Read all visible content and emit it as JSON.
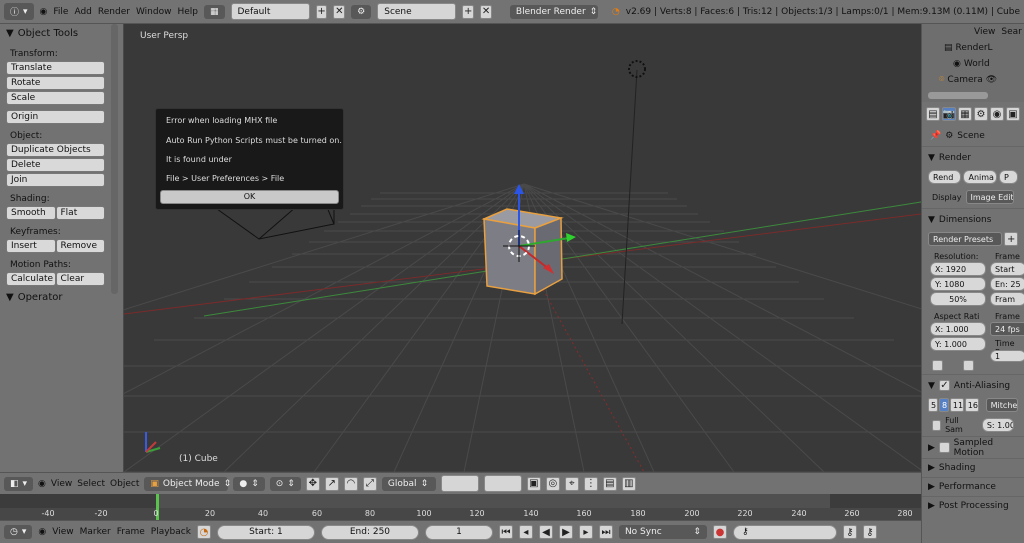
{
  "header": {
    "menus": [
      "File",
      "Add",
      "Render",
      "Window",
      "Help"
    ],
    "screen_layout": "Default",
    "scene": "Scene",
    "render_engine": "Blender Render",
    "stats": "v2.69 | Verts:8 | Faces:6 | Tris:12 | Objects:1/3 | Lamps:0/1 | Mem:9.13M (0.11M) | Cube"
  },
  "tool_shelf": {
    "title": "Object Tools",
    "transform_label": "Transform:",
    "translate": "Translate",
    "rotate": "Rotate",
    "scale": "Scale",
    "origin": "Origin",
    "object_label": "Object:",
    "duplicate": "Duplicate Objects",
    "delete": "Delete",
    "join": "Join",
    "shading_label": "Shading:",
    "smooth": "Smooth",
    "flat": "Flat",
    "keyframes_label": "Keyframes:",
    "insert": "Insert",
    "remove": "Remove",
    "motion_label": "Motion Paths:",
    "calculate": "Calculate",
    "clear": "Clear",
    "operator": "Operator"
  },
  "viewport": {
    "view_name": "User Persp",
    "active_object": "(1) Cube"
  },
  "dialog": {
    "line1": "Error when loading MHX file",
    "line2": "Auto Run Python Scripts must be turned on.",
    "line3": "It is found under",
    "line4": " File > User Preferences > File",
    "ok": "OK"
  },
  "view_header": {
    "view": "View",
    "select": "Select",
    "object": "Object",
    "mode": "Object Mode",
    "orientation": "Global"
  },
  "timeline": {
    "ticks": [
      "-40",
      "-20",
      "0",
      "20",
      "40",
      "60",
      "80",
      "100",
      "120",
      "140",
      "160",
      "180",
      "200",
      "220",
      "240",
      "260",
      "280"
    ]
  },
  "timeline_header": {
    "view": "View",
    "marker": "Marker",
    "frame": "Frame",
    "playback": "Playback",
    "start": "Start: 1",
    "end": "End: 250",
    "current": "1",
    "sync": "No Sync"
  },
  "outliner": {
    "view": "View",
    "search": "Sear",
    "items": [
      "RenderL",
      "World",
      "Camera"
    ]
  },
  "properties": {
    "scene": "Scene",
    "render": "Render",
    "render_btn": "Rend",
    "anim_btn": "Anima",
    "play_btn": "P",
    "display": "Display",
    "display_value": "Image Editor",
    "dimensions": "Dimensions",
    "render_presets": "Render Presets",
    "resolution": "Resolution:",
    "frame_range": "Frame",
    "res_x": "X: 1920",
    "res_y": "Y: 1080",
    "res_pct": "50%",
    "start": "Start",
    "end": "En: 25",
    "frame": "Fram",
    "aspect": "Aspect Rati",
    "frame_rate": "Frame R",
    "asp_x": "X: 1.000",
    "asp_y": "Y: 1.000",
    "fps": "24 fps",
    "time_remap": "Time Re",
    "time_val": "1",
    "anti_aliasing": "Anti-Aliasing",
    "aa_5": "5",
    "aa_8": "8",
    "aa_11": "11",
    "aa_16": "16",
    "filter": "Mitchel",
    "full_sample": "Full Sam",
    "filter_size": "S: 1.00",
    "sampled_motion": "Sampled Motion",
    "shading": "Shading",
    "performance": "Performance",
    "post_processing": "Post Processing"
  }
}
